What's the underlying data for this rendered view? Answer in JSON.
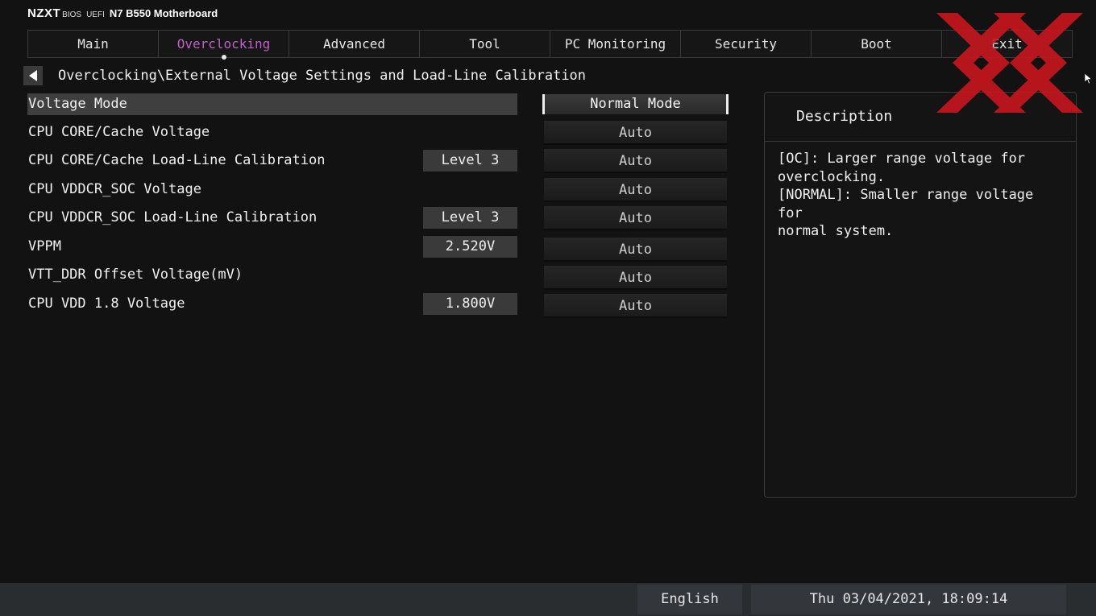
{
  "brand": {
    "logo": "NZXT",
    "bios": "BIOS",
    "uefi": "UEFI",
    "model": "N7 B550 Motherboard"
  },
  "tabs": [
    {
      "label": "Main"
    },
    {
      "label": "Overclocking"
    },
    {
      "label": "Advanced"
    },
    {
      "label": "Tool"
    },
    {
      "label": "PC Monitoring"
    },
    {
      "label": "Security"
    },
    {
      "label": "Boot"
    },
    {
      "label": "Exit"
    }
  ],
  "active_tab": "Overclocking",
  "breadcrumb": "Overclocking\\External Voltage Settings and Load-Line Calibration",
  "settings": [
    {
      "label": "Voltage Mode",
      "current": "",
      "option": "Normal Mode"
    },
    {
      "label": "CPU CORE/Cache Voltage",
      "current": "",
      "option": "Auto"
    },
    {
      "label": "CPU CORE/Cache Load-Line Calibration",
      "current": "Level 3",
      "option": "Auto"
    },
    {
      "label": "CPU VDDCR_SOC Voltage",
      "current": "",
      "option": "Auto"
    },
    {
      "label": "CPU VDDCR_SOC Load-Line Calibration",
      "current": "Level 3",
      "option": "Auto"
    },
    {
      "label": "VPPM",
      "current": "2.520V",
      "option": "Auto"
    },
    {
      "label": "VTT_DDR Offset Voltage(mV)",
      "current": "",
      "option": "Auto"
    },
    {
      "label": "CPU VDD 1.8 Voltage",
      "current": "1.800V",
      "option": "Auto"
    }
  ],
  "description": {
    "title": "Description",
    "text": "[OC]: Larger range voltage for\noverclocking.\n[NORMAL]: Smaller range voltage for\nnormal system."
  },
  "footer": {
    "language": "English",
    "datetime": "Thu 03/04/2021, 18:09:14"
  },
  "colors": {
    "accent": "#c060c8",
    "logo_red": "#c8161e",
    "background": "#121212"
  },
  "icons": {
    "back": "back-arrow-icon",
    "cursor": "mouse-cursor-icon",
    "logo": "xx-watermark-logo"
  }
}
